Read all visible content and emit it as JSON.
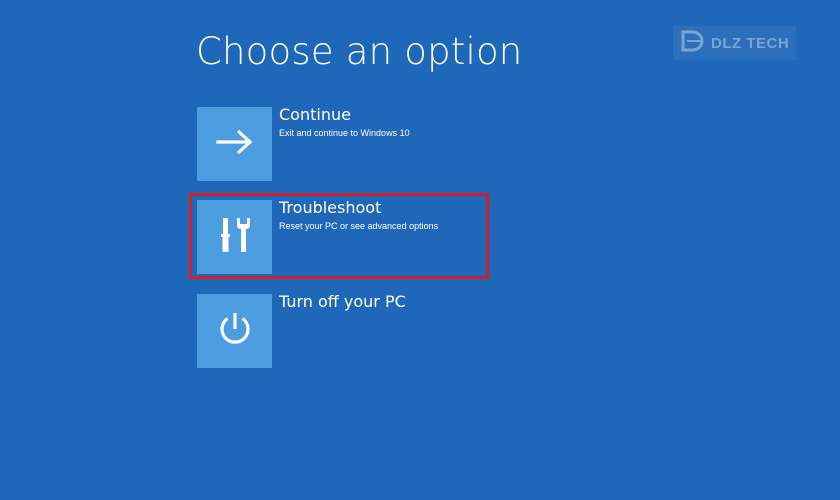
{
  "page": {
    "title": "Choose an option"
  },
  "watermark": {
    "text": "DLZ TECH"
  },
  "options": [
    {
      "label": "Continue",
      "description": "Exit and continue to Windows 10",
      "icon": "arrow-right-icon"
    },
    {
      "label": "Troubleshoot",
      "description": "Reset your PC or see advanced options",
      "icon": "tools-icon"
    },
    {
      "label": "Turn off your PC",
      "description": "",
      "icon": "power-icon"
    }
  ],
  "colors": {
    "background": "#1f67b9",
    "tile": "#4c9ee0",
    "highlight": "#d21f2c",
    "text": "#ffffff"
  }
}
